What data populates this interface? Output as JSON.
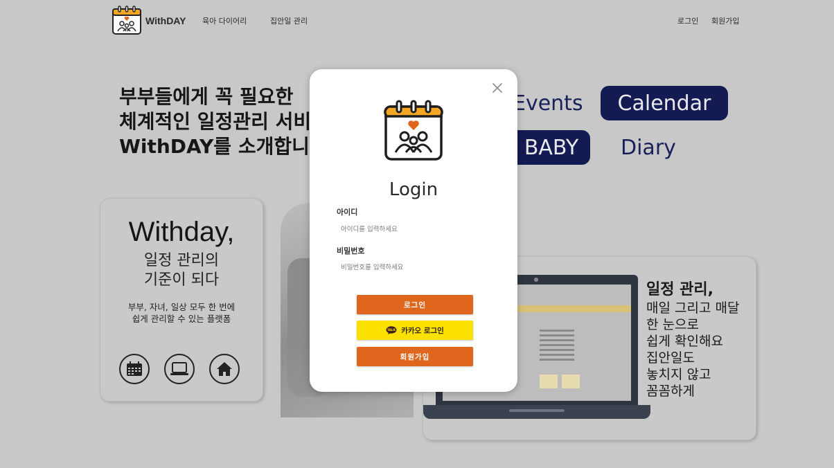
{
  "header": {
    "logo_text": "WithDAY",
    "nav": [
      "육아 다이어리",
      "집안일 관리"
    ],
    "login": "로그인",
    "signup": "회원가입"
  },
  "hero": {
    "title_lines": [
      "부부들에게 꼭 필요한",
      "체계적인 일정관리 서비",
      "WithDAY를 소개합니"
    ],
    "pills": [
      "Events",
      "Calendar",
      "BABY",
      "Diary"
    ]
  },
  "card_left": {
    "title": "Withday,",
    "subtitle_lines": [
      "일정 관리의",
      "기준이 되다"
    ],
    "desc_lines": [
      "부부, 자녀, 일상 모두 한 번에",
      "쉽게 관리할 수 있는 플랫폼"
    ],
    "icons": [
      "calendar-icon",
      "laptop-icon",
      "home-icon"
    ]
  },
  "card_right": {
    "lines": [
      "일정 관리,",
      "매일 그리고 매달",
      "한 눈으로",
      "쉽게 확인해요",
      "집안일도",
      "놓치지 않고",
      "꼼꼼하게"
    ]
  },
  "modal": {
    "title": "Login",
    "id_label": "아이디",
    "id_placeholder": "아이디를 입력하세요",
    "pw_label": "비밀번호",
    "pw_placeholder": "비밀번호를 입력하세요",
    "login_button": "로그인",
    "kakao_button": "카카오 로그인",
    "kakao_badge": "TALK",
    "signup_button": "회원가입"
  },
  "colors": {
    "accent_orange": "#e0661e",
    "kakao_yellow": "#fae100",
    "navy": "#141b52",
    "overlay_gray": "#c8c8c8"
  }
}
